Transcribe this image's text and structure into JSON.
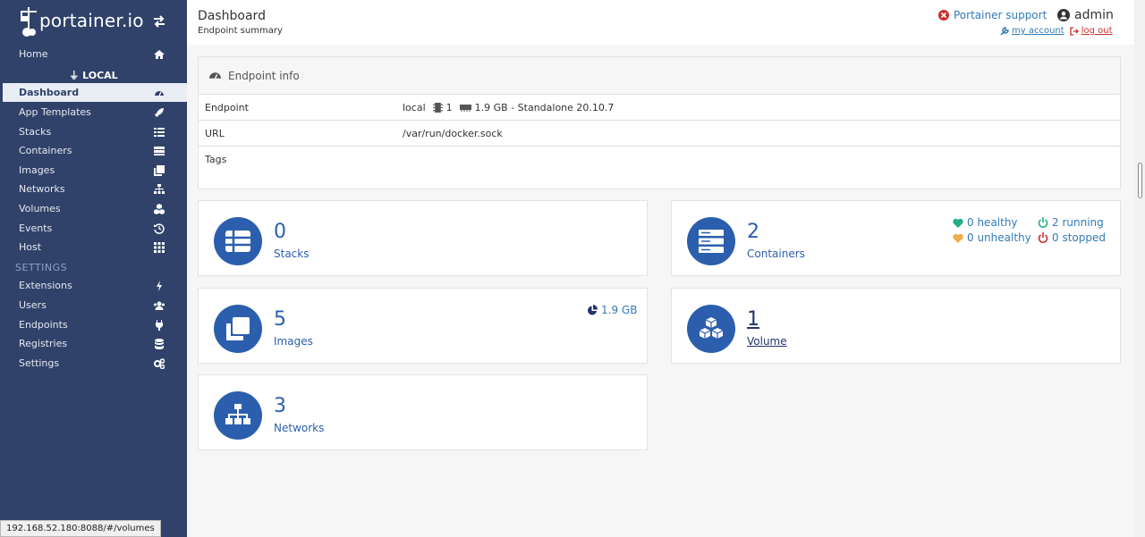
{
  "brand": {
    "name": "portainer.io"
  },
  "sidebar": {
    "home": "Home",
    "endpoint_name": "LOCAL",
    "items": [
      {
        "label": "Dashboard",
        "icon": "tachometer-icon"
      },
      {
        "label": "App Templates",
        "icon": "rocket-icon"
      },
      {
        "label": "Stacks",
        "icon": "th-list-icon"
      },
      {
        "label": "Containers",
        "icon": "server-icon"
      },
      {
        "label": "Images",
        "icon": "clone-icon"
      },
      {
        "label": "Networks",
        "icon": "sitemap-icon"
      },
      {
        "label": "Volumes",
        "icon": "cubes-icon"
      },
      {
        "label": "Events",
        "icon": "history-icon"
      },
      {
        "label": "Host",
        "icon": "th-icon"
      }
    ],
    "settings_heading": "SETTINGS",
    "settings_items": [
      {
        "label": "Extensions",
        "icon": "bolt-icon"
      },
      {
        "label": "Users",
        "icon": "users-icon"
      },
      {
        "label": "Endpoints",
        "icon": "plug-icon"
      },
      {
        "label": "Registries",
        "icon": "database-icon"
      },
      {
        "label": "Settings",
        "icon": "cogs-icon"
      }
    ]
  },
  "header": {
    "title": "Dashboard",
    "subtitle": "Endpoint summary",
    "support": "Portainer support",
    "user": "admin",
    "my_account": "my account",
    "log_out": "log out"
  },
  "endpoint_info": {
    "title": "Endpoint info",
    "rows": {
      "endpoint_label": "Endpoint",
      "endpoint_name": "local",
      "cpu": "1",
      "memory_engine": "1.9 GB - Standalone 20.10.7",
      "url_label": "URL",
      "url_value": "/var/run/docker.sock",
      "tags_label": "Tags"
    }
  },
  "cards": {
    "stacks": {
      "count": "0",
      "label": "Stacks"
    },
    "containers": {
      "count": "2",
      "label": "Containers",
      "healthy": "0 healthy",
      "unhealthy": "0 unhealthy",
      "running": "2 running",
      "stopped": "0 stopped"
    },
    "images": {
      "count": "5",
      "label": "Images",
      "size": "1.9 GB"
    },
    "volumes": {
      "count": "1",
      "label": "Volume"
    },
    "networks": {
      "count": "3",
      "label": "Networks"
    }
  },
  "colors": {
    "sidebar": "#30426a",
    "accent": "#2b5fad",
    "link": "#337ab7",
    "danger": "#c9302c",
    "success": "#23ae89",
    "warning": "#f0ad4e"
  },
  "status_bar": {
    "url": "192.168.52.180:8088/#/volumes"
  }
}
